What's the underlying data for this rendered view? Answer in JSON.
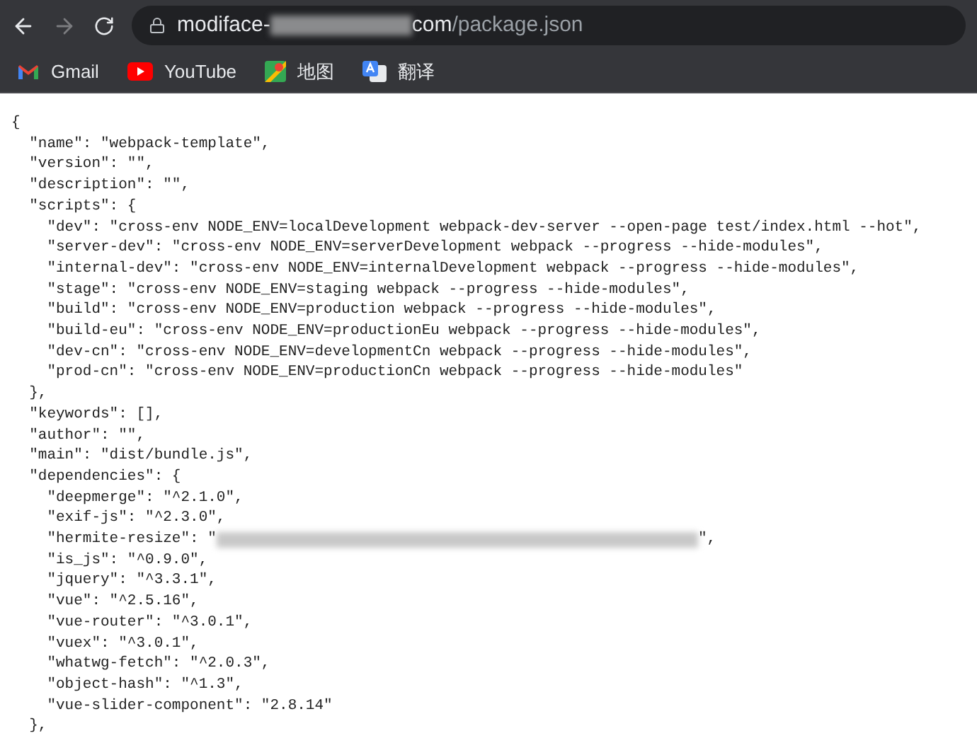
{
  "address_bar": {
    "host_start": "modiface-",
    "host_end": "com",
    "path": "/package.json"
  },
  "bookmarks": [
    {
      "label": "Gmail",
      "kind": "gmail"
    },
    {
      "label": "YouTube",
      "kind": "youtube"
    },
    {
      "label": "地图",
      "kind": "maps"
    },
    {
      "label": "翻译",
      "kind": "translate"
    }
  ],
  "code_lines": [
    {
      "kind": "line",
      "text": "{"
    },
    {
      "kind": "line",
      "text": "  \"name\": \"webpack-template\","
    },
    {
      "kind": "line",
      "text": "  \"version\": \"\","
    },
    {
      "kind": "line",
      "text": "  \"description\": \"\","
    },
    {
      "kind": "line",
      "text": "  \"scripts\": {"
    },
    {
      "kind": "line",
      "text": "    \"dev\": \"cross-env NODE_ENV=localDevelopment webpack-dev-server --open-page test/index.html --hot\","
    },
    {
      "kind": "line",
      "text": "    \"server-dev\": \"cross-env NODE_ENV=serverDevelopment webpack --progress --hide-modules\","
    },
    {
      "kind": "line",
      "text": "    \"internal-dev\": \"cross-env NODE_ENV=internalDevelopment webpack --progress --hide-modules\","
    },
    {
      "kind": "line",
      "text": "    \"stage\": \"cross-env NODE_ENV=staging webpack --progress --hide-modules\","
    },
    {
      "kind": "line",
      "text": "    \"build\": \"cross-env NODE_ENV=production webpack --progress --hide-modules\","
    },
    {
      "kind": "line",
      "text": "    \"build-eu\": \"cross-env NODE_ENV=productionEu webpack --progress --hide-modules\","
    },
    {
      "kind": "line",
      "text": "    \"dev-cn\": \"cross-env NODE_ENV=developmentCn webpack --progress --hide-modules\","
    },
    {
      "kind": "line",
      "text": "    \"prod-cn\": \"cross-env NODE_ENV=productionCn webpack --progress --hide-modules\""
    },
    {
      "kind": "line",
      "text": "  },"
    },
    {
      "kind": "line",
      "text": "  \"keywords\": [],"
    },
    {
      "kind": "line",
      "text": "  \"author\": \"\","
    },
    {
      "kind": "line",
      "text": "  \"main\": \"dist/bundle.js\","
    },
    {
      "kind": "line",
      "text": "  \"dependencies\": {"
    },
    {
      "kind": "line",
      "text": "    \"deepmerge\": \"^2.1.0\","
    },
    {
      "kind": "line",
      "text": "    \"exif-js\": \"^2.3.0\","
    },
    {
      "kind": "redacted",
      "text": "    \"hermite-resize\": \"",
      "after": "\","
    },
    {
      "kind": "line",
      "text": "    \"is_js\": \"^0.9.0\","
    },
    {
      "kind": "line",
      "text": "    \"jquery\": \"^3.3.1\","
    },
    {
      "kind": "line",
      "text": "    \"vue\": \"^2.5.16\","
    },
    {
      "kind": "line",
      "text": "    \"vue-router\": \"^3.0.1\","
    },
    {
      "kind": "line",
      "text": "    \"vuex\": \"^3.0.1\","
    },
    {
      "kind": "line",
      "text": "    \"whatwg-fetch\": \"^2.0.3\","
    },
    {
      "kind": "line",
      "text": "    \"object-hash\": \"^1.3\","
    },
    {
      "kind": "line",
      "text": "    \"vue-slider-component\": \"2.8.14\""
    },
    {
      "kind": "line",
      "text": "  },"
    }
  ]
}
